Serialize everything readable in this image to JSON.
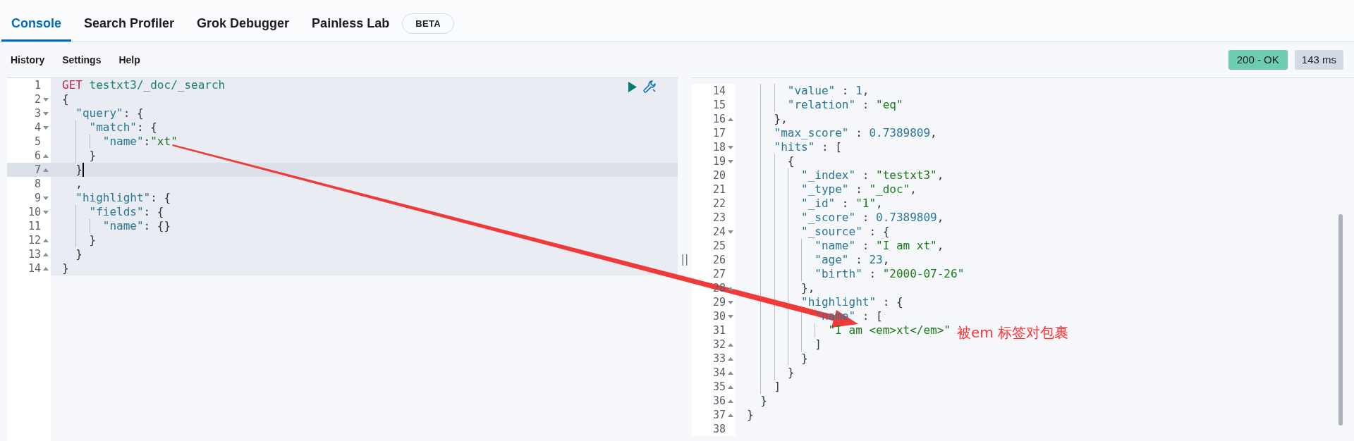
{
  "tabs": [
    {
      "label": "Console",
      "selected": true
    },
    {
      "label": "Search Profiler",
      "selected": false
    },
    {
      "label": "Grok Debugger",
      "selected": false
    },
    {
      "label": "Painless Lab",
      "selected": false,
      "badge": "BETA"
    }
  ],
  "menu": [
    "History",
    "Settings",
    "Help"
  ],
  "status": {
    "code": "200 - OK",
    "time": "143 ms"
  },
  "request_editor": {
    "lines": [
      {
        "number": "1",
        "fold_start": false,
        "fold_end": false,
        "active": false,
        "tokens": [
          {
            "kind": "method",
            "text": "GET"
          },
          {
            "kind": "url",
            "text": " testxt3/_doc/_search"
          }
        ]
      },
      {
        "number": "2",
        "fold_start": true,
        "fold_end": false,
        "active": false,
        "tokens": [
          {
            "kind": "punct",
            "text": "{"
          }
        ]
      },
      {
        "number": "3",
        "fold_start": true,
        "fold_end": false,
        "active": false,
        "tokens": [
          {
            "kind": "key",
            "text": "  \"query\""
          },
          {
            "kind": "punct",
            "text": ": {"
          }
        ]
      },
      {
        "number": "4",
        "fold_start": true,
        "fold_end": false,
        "active": false,
        "tokens": [
          {
            "kind": "key",
            "text": "    \"match\""
          },
          {
            "kind": "punct",
            "text": ": {"
          }
        ]
      },
      {
        "number": "5",
        "fold_start": false,
        "fold_end": false,
        "active": false,
        "tokens": [
          {
            "kind": "key",
            "text": "      \"name\""
          },
          {
            "kind": "punct",
            "text": ":"
          },
          {
            "kind": "string",
            "text": "\"xt\""
          }
        ]
      },
      {
        "number": "6",
        "fold_start": false,
        "fold_end": true,
        "active": false,
        "tokens": [
          {
            "kind": "punct",
            "text": "    }"
          }
        ]
      },
      {
        "number": "7",
        "fold_start": false,
        "fold_end": true,
        "active": true,
        "tokens": [
          {
            "kind": "punct",
            "text": "  }"
          }
        ]
      },
      {
        "number": "8",
        "fold_start": false,
        "fold_end": false,
        "active": false,
        "tokens": [
          {
            "kind": "punct",
            "text": "  ,"
          }
        ]
      },
      {
        "number": "9",
        "fold_start": true,
        "fold_end": false,
        "active": false,
        "tokens": [
          {
            "kind": "key",
            "text": "  \"highlight\""
          },
          {
            "kind": "punct",
            "text": ": {"
          }
        ]
      },
      {
        "number": "10",
        "fold_start": true,
        "fold_end": false,
        "active": false,
        "tokens": [
          {
            "kind": "key",
            "text": "    \"fields\""
          },
          {
            "kind": "punct",
            "text": ": {"
          }
        ]
      },
      {
        "number": "11",
        "fold_start": false,
        "fold_end": false,
        "active": false,
        "tokens": [
          {
            "kind": "key",
            "text": "      \"name\""
          },
          {
            "kind": "punct",
            "text": ": {}"
          }
        ]
      },
      {
        "number": "12",
        "fold_start": false,
        "fold_end": true,
        "active": false,
        "tokens": [
          {
            "kind": "punct",
            "text": "    }"
          }
        ]
      },
      {
        "number": "13",
        "fold_start": false,
        "fold_end": true,
        "active": false,
        "tokens": [
          {
            "kind": "punct",
            "text": "  }"
          }
        ]
      },
      {
        "number": "14",
        "fold_start": false,
        "fold_end": true,
        "active": false,
        "tokens": [
          {
            "kind": "punct",
            "text": "}"
          }
        ]
      }
    ]
  },
  "splitter": "||",
  "response_viewer": {
    "lines": [
      {
        "number": "14",
        "fold_start": false,
        "fold_end": false,
        "tokens": [
          {
            "kind": "key",
            "text": "      \"value\""
          },
          {
            "kind": "punct",
            "text": " : "
          },
          {
            "kind": "number",
            "text": "1"
          },
          {
            "kind": "punct",
            "text": ","
          }
        ]
      },
      {
        "number": "15",
        "fold_start": false,
        "fold_end": false,
        "tokens": [
          {
            "kind": "key",
            "text": "      \"relation\""
          },
          {
            "kind": "punct",
            "text": " : "
          },
          {
            "kind": "string",
            "text": "\"eq\""
          }
        ]
      },
      {
        "number": "16",
        "fold_start": false,
        "fold_end": true,
        "tokens": [
          {
            "kind": "punct",
            "text": "    },"
          }
        ]
      },
      {
        "number": "17",
        "fold_start": false,
        "fold_end": false,
        "tokens": [
          {
            "kind": "key",
            "text": "    \"max_score\""
          },
          {
            "kind": "punct",
            "text": " : "
          },
          {
            "kind": "number",
            "text": "0.7389809"
          },
          {
            "kind": "punct",
            "text": ","
          }
        ]
      },
      {
        "number": "18",
        "fold_start": true,
        "fold_end": false,
        "tokens": [
          {
            "kind": "key",
            "text": "    \"hits\""
          },
          {
            "kind": "punct",
            "text": " : ["
          }
        ]
      },
      {
        "number": "19",
        "fold_start": true,
        "fold_end": false,
        "tokens": [
          {
            "kind": "punct",
            "text": "      {"
          }
        ]
      },
      {
        "number": "20",
        "fold_start": false,
        "fold_end": false,
        "tokens": [
          {
            "kind": "key",
            "text": "        \"_index\""
          },
          {
            "kind": "punct",
            "text": " : "
          },
          {
            "kind": "string",
            "text": "\"testxt3\""
          },
          {
            "kind": "punct",
            "text": ","
          }
        ]
      },
      {
        "number": "21",
        "fold_start": false,
        "fold_end": false,
        "tokens": [
          {
            "kind": "key",
            "text": "        \"_type\""
          },
          {
            "kind": "punct",
            "text": " : "
          },
          {
            "kind": "string",
            "text": "\"_doc\""
          },
          {
            "kind": "punct",
            "text": ","
          }
        ]
      },
      {
        "number": "22",
        "fold_start": false,
        "fold_end": false,
        "tokens": [
          {
            "kind": "key",
            "text": "        \"_id\""
          },
          {
            "kind": "punct",
            "text": " : "
          },
          {
            "kind": "string",
            "text": "\"1\""
          },
          {
            "kind": "punct",
            "text": ","
          }
        ]
      },
      {
        "number": "23",
        "fold_start": false,
        "fold_end": false,
        "tokens": [
          {
            "kind": "key",
            "text": "        \"_score\""
          },
          {
            "kind": "punct",
            "text": " : "
          },
          {
            "kind": "number",
            "text": "0.7389809"
          },
          {
            "kind": "punct",
            "text": ","
          }
        ]
      },
      {
        "number": "24",
        "fold_start": true,
        "fold_end": false,
        "tokens": [
          {
            "kind": "key",
            "text": "        \"_source\""
          },
          {
            "kind": "punct",
            "text": " : {"
          }
        ]
      },
      {
        "number": "25",
        "fold_start": false,
        "fold_end": false,
        "tokens": [
          {
            "kind": "key",
            "text": "          \"name\""
          },
          {
            "kind": "punct",
            "text": " : "
          },
          {
            "kind": "string",
            "text": "\"I am xt\""
          },
          {
            "kind": "punct",
            "text": ","
          }
        ]
      },
      {
        "number": "26",
        "fold_start": false,
        "fold_end": false,
        "tokens": [
          {
            "kind": "key",
            "text": "          \"age\""
          },
          {
            "kind": "punct",
            "text": " : "
          },
          {
            "kind": "number",
            "text": "23"
          },
          {
            "kind": "punct",
            "text": ","
          }
        ]
      },
      {
        "number": "27",
        "fold_start": false,
        "fold_end": false,
        "tokens": [
          {
            "kind": "key",
            "text": "          \"birth\""
          },
          {
            "kind": "punct",
            "text": " : "
          },
          {
            "kind": "string",
            "text": "\"2000-07-26\""
          }
        ]
      },
      {
        "number": "28",
        "fold_start": false,
        "fold_end": true,
        "tokens": [
          {
            "kind": "punct",
            "text": "        },"
          }
        ]
      },
      {
        "number": "29",
        "fold_start": true,
        "fold_end": false,
        "tokens": [
          {
            "kind": "key",
            "text": "        \"highlight\""
          },
          {
            "kind": "punct",
            "text": " : {"
          }
        ]
      },
      {
        "number": "30",
        "fold_start": true,
        "fold_end": false,
        "tokens": [
          {
            "kind": "key",
            "text": "          \"name\""
          },
          {
            "kind": "punct",
            "text": " : ["
          }
        ]
      },
      {
        "number": "31",
        "fold_start": false,
        "fold_end": false,
        "tokens": [
          {
            "kind": "string",
            "text": "            \"I am <em>xt</em>\""
          }
        ]
      },
      {
        "number": "32",
        "fold_start": false,
        "fold_end": true,
        "tokens": [
          {
            "kind": "punct",
            "text": "          ]"
          }
        ]
      },
      {
        "number": "33",
        "fold_start": false,
        "fold_end": true,
        "tokens": [
          {
            "kind": "punct",
            "text": "        }"
          }
        ]
      },
      {
        "number": "34",
        "fold_start": false,
        "fold_end": true,
        "tokens": [
          {
            "kind": "punct",
            "text": "      }"
          }
        ]
      },
      {
        "number": "35",
        "fold_start": false,
        "fold_end": true,
        "tokens": [
          {
            "kind": "punct",
            "text": "    ]"
          }
        ]
      },
      {
        "number": "36",
        "fold_start": false,
        "fold_end": true,
        "tokens": [
          {
            "kind": "punct",
            "text": "  }"
          }
        ]
      },
      {
        "number": "37",
        "fold_start": false,
        "fold_end": true,
        "tokens": [
          {
            "kind": "punct",
            "text": "}"
          }
        ]
      },
      {
        "number": "38",
        "fold_start": false,
        "fold_end": false
      }
    ]
  },
  "annotation": "被em 标签对包裹"
}
